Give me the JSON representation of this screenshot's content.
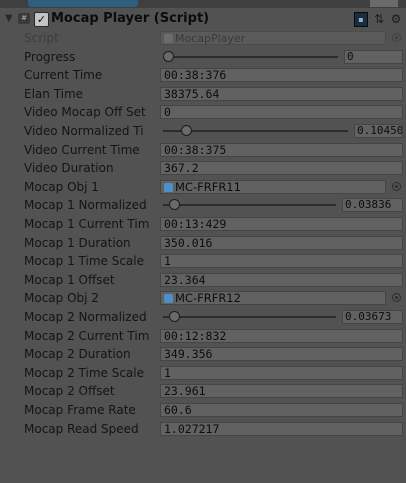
{
  "component": {
    "title": "Mocap Player (Script)",
    "colors": {
      "panel_bg": "#525252",
      "field_bg": "#616161",
      "object_icon": "#4d8fc9"
    }
  },
  "header_icons": [
    "fold-arrow-icon",
    "script-icon",
    "enable-checkbox",
    "book-icon",
    "settings-sliders-icon",
    "gear-icon"
  ],
  "rows": [
    {
      "label": "Script",
      "type": "object",
      "value": "MocapPlayer",
      "disabled": true
    },
    {
      "label": "Progress",
      "type": "slider",
      "value": "0",
      "fraction": 0.0
    },
    {
      "label": "Current Time",
      "type": "text",
      "value": "00:38:376"
    },
    {
      "label": "Elan Time",
      "type": "text",
      "value": "38375.64"
    },
    {
      "label": "Video Mocap Off Set",
      "type": "text",
      "value": "0"
    },
    {
      "label": "Video Normalized Ti",
      "type": "slider",
      "value": "0.10450",
      "fraction": 0.1045
    },
    {
      "label": "Video Current Time",
      "type": "text",
      "value": "00:38:375"
    },
    {
      "label": "Video Duration",
      "type": "text",
      "value": "367.2"
    },
    {
      "label": "Mocap Obj 1",
      "type": "object",
      "value": "MC-FRFR11"
    },
    {
      "label": "Mocap 1 Normalized",
      "type": "slider",
      "value": "0.03836",
      "fraction": 0.03836
    },
    {
      "label": "Mocap 1 Current Tim",
      "type": "text",
      "value": "00:13:429"
    },
    {
      "label": "Mocap 1 Duration",
      "type": "text",
      "value": "350.016"
    },
    {
      "label": "Mocap 1 Time Scale",
      "type": "text",
      "value": "1"
    },
    {
      "label": "Mocap 1 Offset",
      "type": "text",
      "value": "23.364"
    },
    {
      "label": "Mocap Obj 2",
      "type": "object",
      "value": "MC-FRFR12"
    },
    {
      "label": "Mocap 2 Normalized",
      "type": "slider",
      "value": "0.03673",
      "fraction": 0.03673
    },
    {
      "label": "Mocap 2 Current Tim",
      "type": "text",
      "value": "00:12:832"
    },
    {
      "label": "Mocap 2 Duration",
      "type": "text",
      "value": "349.356"
    },
    {
      "label": "Mocap 2 Time Scale",
      "type": "text",
      "value": "1"
    },
    {
      "label": "Mocap 2 Offset",
      "type": "text",
      "value": "23.961"
    },
    {
      "label": "Mocap Frame Rate",
      "type": "text",
      "value": "60.6"
    },
    {
      "label": "Mocap Read Speed",
      "type": "text",
      "value": "1.027217"
    }
  ]
}
